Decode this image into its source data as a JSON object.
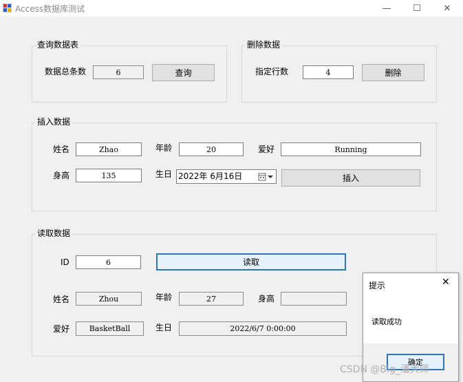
{
  "window": {
    "title": "Access数据库测试",
    "min": "—",
    "max": "☐",
    "close": "✕"
  },
  "query_group": {
    "title": "查询数据表",
    "count_label": "数据总条数",
    "count_value": "6",
    "query_button": "查询"
  },
  "delete_group": {
    "title": "删除数据",
    "row_label": "指定行数",
    "row_value": "4",
    "delete_button": "删除"
  },
  "insert_group": {
    "title": "插入数据",
    "name_label": "姓名",
    "name_value": "Zhao",
    "age_label": "年龄",
    "age_value": "20",
    "hobby_label": "爱好",
    "hobby_value": "Running",
    "height_label": "身高",
    "height_value": "135",
    "birthday_label": "生日",
    "birthday_value": "2022年  6月16日",
    "insert_button": "插入"
  },
  "read_group": {
    "title": "读取数据",
    "id_label": "ID",
    "id_value": "6",
    "read_button": "读取",
    "name_label": "姓名",
    "name_value": "Zhou",
    "age_label": "年龄",
    "age_value": "27",
    "height_label": "身高",
    "height_value": "",
    "hobby_label": "爱好",
    "hobby_value": "BasketBall",
    "birthday_label": "生日",
    "birthday_value": "2022/6/7 0:00:00"
  },
  "message_box": {
    "title": "提示",
    "text": "读取成功",
    "ok_button": "确定",
    "close": "✕"
  },
  "watermark": "CSDN @Big_潘大师"
}
